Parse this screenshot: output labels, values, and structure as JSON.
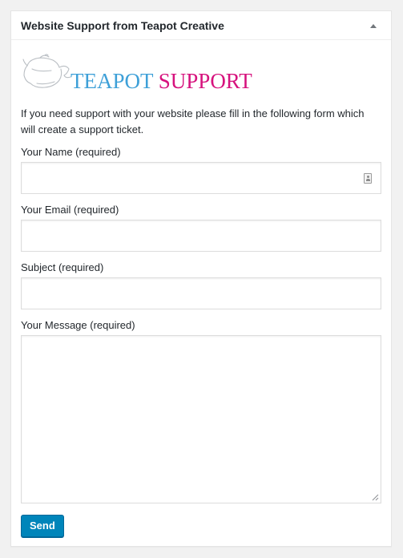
{
  "widget": {
    "title": "Website Support from Teapot Creative",
    "toggle_icon": "triangle-up-icon"
  },
  "logo": {
    "word1": "TEAPOT",
    "word2": "SUPPORT",
    "icon": "teapot-icon",
    "colors": {
      "word1": "#3ea0d8",
      "word2": "#d6127d"
    }
  },
  "intro_text": "If you need support with your website please fill in the following form which will create a support ticket.",
  "form": {
    "name_label": "Your Name (required)",
    "name_value": "",
    "email_label": "Your Email (required)",
    "email_value": "",
    "subject_label": "Subject (required)",
    "subject_value": "",
    "message_label": "Your Message (required)",
    "message_value": "",
    "submit_label": "Send"
  },
  "colors": {
    "button_bg": "#0085ba",
    "button_border": "#006799",
    "background": "#f1f1f1"
  }
}
